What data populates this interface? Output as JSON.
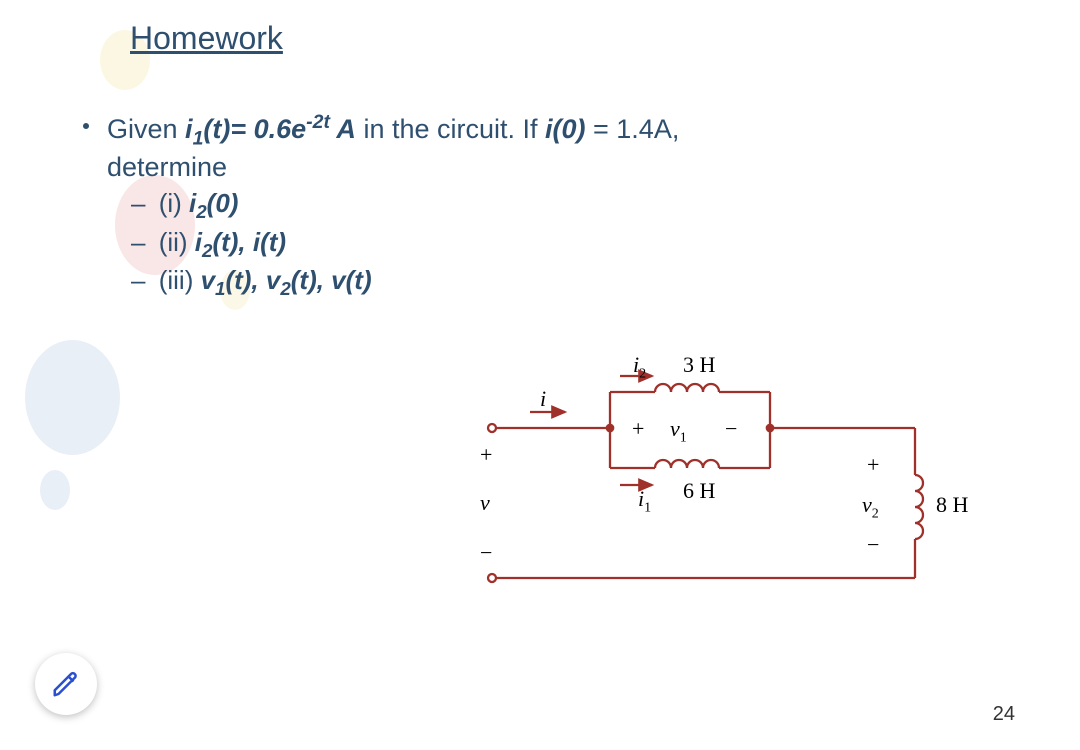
{
  "slide": {
    "title": "Homework",
    "page_number": "24",
    "given_prefix": "Given ",
    "i1_t": "i",
    "i1_sub": "1",
    "i1_arg": "(t)= 0.6e",
    "exp": "-2t",
    "after_exp": " A",
    "mid_text": " in the circuit. If ",
    "i0": "i(0)",
    "eq_text": " = 1.4A,",
    "determine": "determine",
    "items": {
      "a_num": "(i) ",
      "a_body": "i",
      "a_sub": "2",
      "a_tail": "(0)",
      "b_num": "(ii) ",
      "b_body": "i",
      "b_sub": "2",
      "b_tail": "(t),  i(t)",
      "c_num": "(iii) ",
      "c_v1": "v",
      "c_v1s": "1",
      "c_m1": "(t), ",
      "c_v2": "v",
      "c_v2s": "2",
      "c_m2": "(t), ",
      "c_v": "v(t)"
    }
  },
  "circuit": {
    "i": "i",
    "i1": "i",
    "i1s": "1",
    "i2": "i",
    "i2s": "2",
    "v": "v",
    "v1": "v",
    "v1s": "1",
    "v2": "v",
    "v2s": "2",
    "L1": "3 H",
    "L2": "6 H",
    "L3": "8 H",
    "plus": "+",
    "minus": "−"
  }
}
